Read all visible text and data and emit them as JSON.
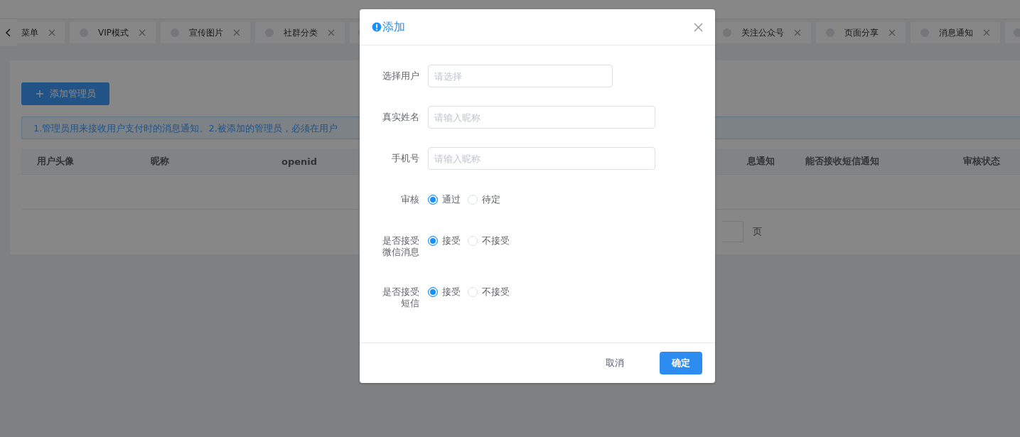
{
  "tabs_bar": {
    "tabs": [
      {
        "kind": "tab",
        "label": "菜单",
        "dot": false
      },
      {
        "kind": "tab",
        "label": "VIP模式",
        "dot": true
      },
      {
        "kind": "tab",
        "label": "宣传图片",
        "dot": true
      },
      {
        "kind": "tab",
        "label": "社群分类",
        "dot": true
      },
      {
        "kind": "stub"
      },
      {
        "kind": "gap"
      },
      {
        "kind": "tab",
        "label": "关注公众号",
        "dot": true
      },
      {
        "kind": "tab",
        "label": "页面分享",
        "dot": true
      },
      {
        "kind": "tab",
        "label": "消息通知",
        "dot": true
      },
      {
        "kind": "stub"
      }
    ]
  },
  "page": {
    "add_button": "添加管理员",
    "notice": "1.管理员用来接收用户支付时的消息通知。2.被添加的管理员，必须在用户",
    "table": {
      "columns": [
        {
          "kind": "col",
          "label": "用户头像"
        },
        {
          "kind": "col",
          "label": "昵称"
        },
        {
          "kind": "col",
          "label": "openid"
        },
        {
          "kind": "gap"
        },
        {
          "kind": "col",
          "label": "息通知"
        },
        {
          "kind": "col",
          "label": "能否接收短信通知"
        },
        {
          "kind": "col",
          "label": "审核状态"
        }
      ]
    },
    "pagination": {
      "suffix": "页"
    }
  },
  "dialog": {
    "title": "添加",
    "fields": [
      {
        "kind": "select",
        "label": "选择用户",
        "placeholder": "请选择"
      },
      {
        "kind": "input",
        "label": "真实姓名",
        "placeholder": "请输入昵称"
      },
      {
        "kind": "input",
        "label": "手机号",
        "placeholder": "请输入昵称"
      }
    ],
    "radio_groups": [
      {
        "label": "审核",
        "options": [
          {
            "label": "通过",
            "selected": true
          },
          {
            "label": "待定",
            "selected": false
          }
        ]
      },
      {
        "label": "是否接受微信消息",
        "options": [
          {
            "label": "接受",
            "selected": true
          },
          {
            "label": "不接受",
            "selected": false
          }
        ]
      },
      {
        "label": "是否接受短信",
        "options": [
          {
            "label": "接受",
            "selected": true
          },
          {
            "label": "不接受",
            "selected": false
          }
        ]
      }
    ],
    "buttons": [
      {
        "kind": "text",
        "label": "取消"
      },
      {
        "kind": "primary",
        "label": "确定"
      }
    ]
  }
}
